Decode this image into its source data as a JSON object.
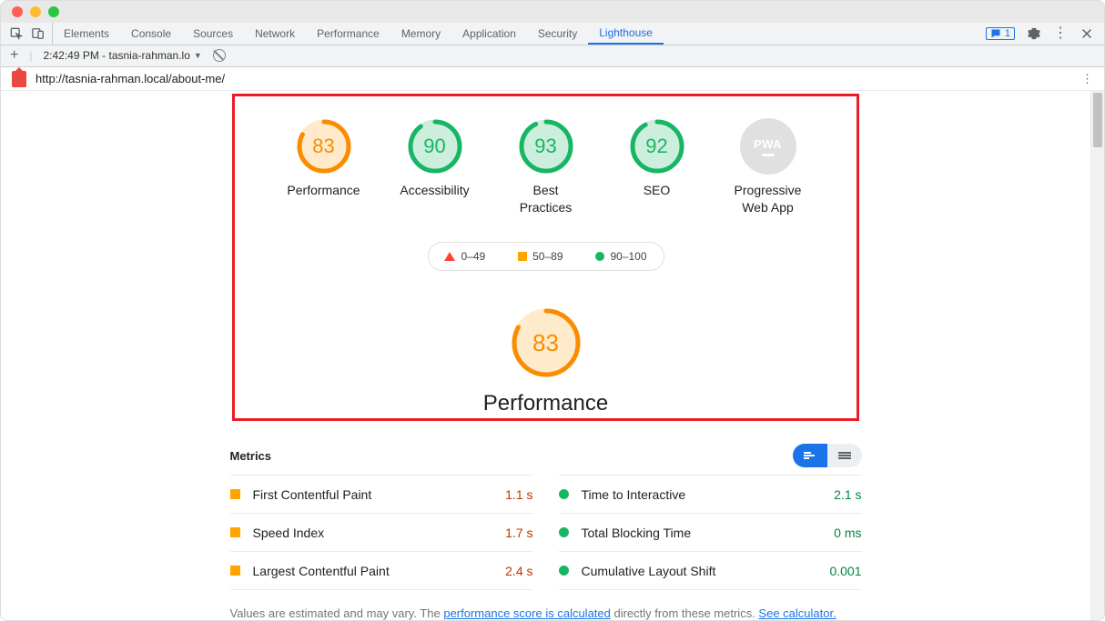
{
  "devtools_tabs": [
    "Elements",
    "Console",
    "Sources",
    "Network",
    "Performance",
    "Memory",
    "Application",
    "Security",
    "Lighthouse"
  ],
  "devtools_active_tab": "Lighthouse",
  "messages_badge": "1",
  "sub_toolbar": {
    "time_label": "2:42:49 PM - tasnia-rahman.lo"
  },
  "url": "http://tasnia-rahman.local/about-me/",
  "gauges": [
    {
      "score": 83,
      "label": "Performance",
      "status": "average"
    },
    {
      "score": 90,
      "label": "Accessibility",
      "status": "pass"
    },
    {
      "score": 93,
      "label": "Best Practices",
      "status": "pass"
    },
    {
      "score": 92,
      "label": "SEO",
      "status": "pass"
    }
  ],
  "pwa_label": "Progressive Web App",
  "legend": {
    "fail": "0–49",
    "average": "50–89",
    "pass": "90–100"
  },
  "big_gauge": {
    "score": 83,
    "title": "Performance"
  },
  "metrics_heading": "Metrics",
  "metrics_left": [
    {
      "name": "First Contentful Paint",
      "value": "1.1 s",
      "status": "average"
    },
    {
      "name": "Speed Index",
      "value": "1.7 s",
      "status": "average"
    },
    {
      "name": "Largest Contentful Paint",
      "value": "2.4 s",
      "status": "average"
    }
  ],
  "metrics_right": [
    {
      "name": "Time to Interactive",
      "value": "2.1 s",
      "status": "pass"
    },
    {
      "name": "Total Blocking Time",
      "value": "0 ms",
      "status": "pass"
    },
    {
      "name": "Cumulative Layout Shift",
      "value": "0.001",
      "status": "pass"
    }
  ],
  "footnote": {
    "pre": "Values are estimated and may vary. The ",
    "link1": "performance score is calculated",
    "mid": " directly from these metrics. ",
    "link2": "See calculator."
  },
  "colors": {
    "average": "#fb8c00",
    "pass": "#18b663"
  }
}
